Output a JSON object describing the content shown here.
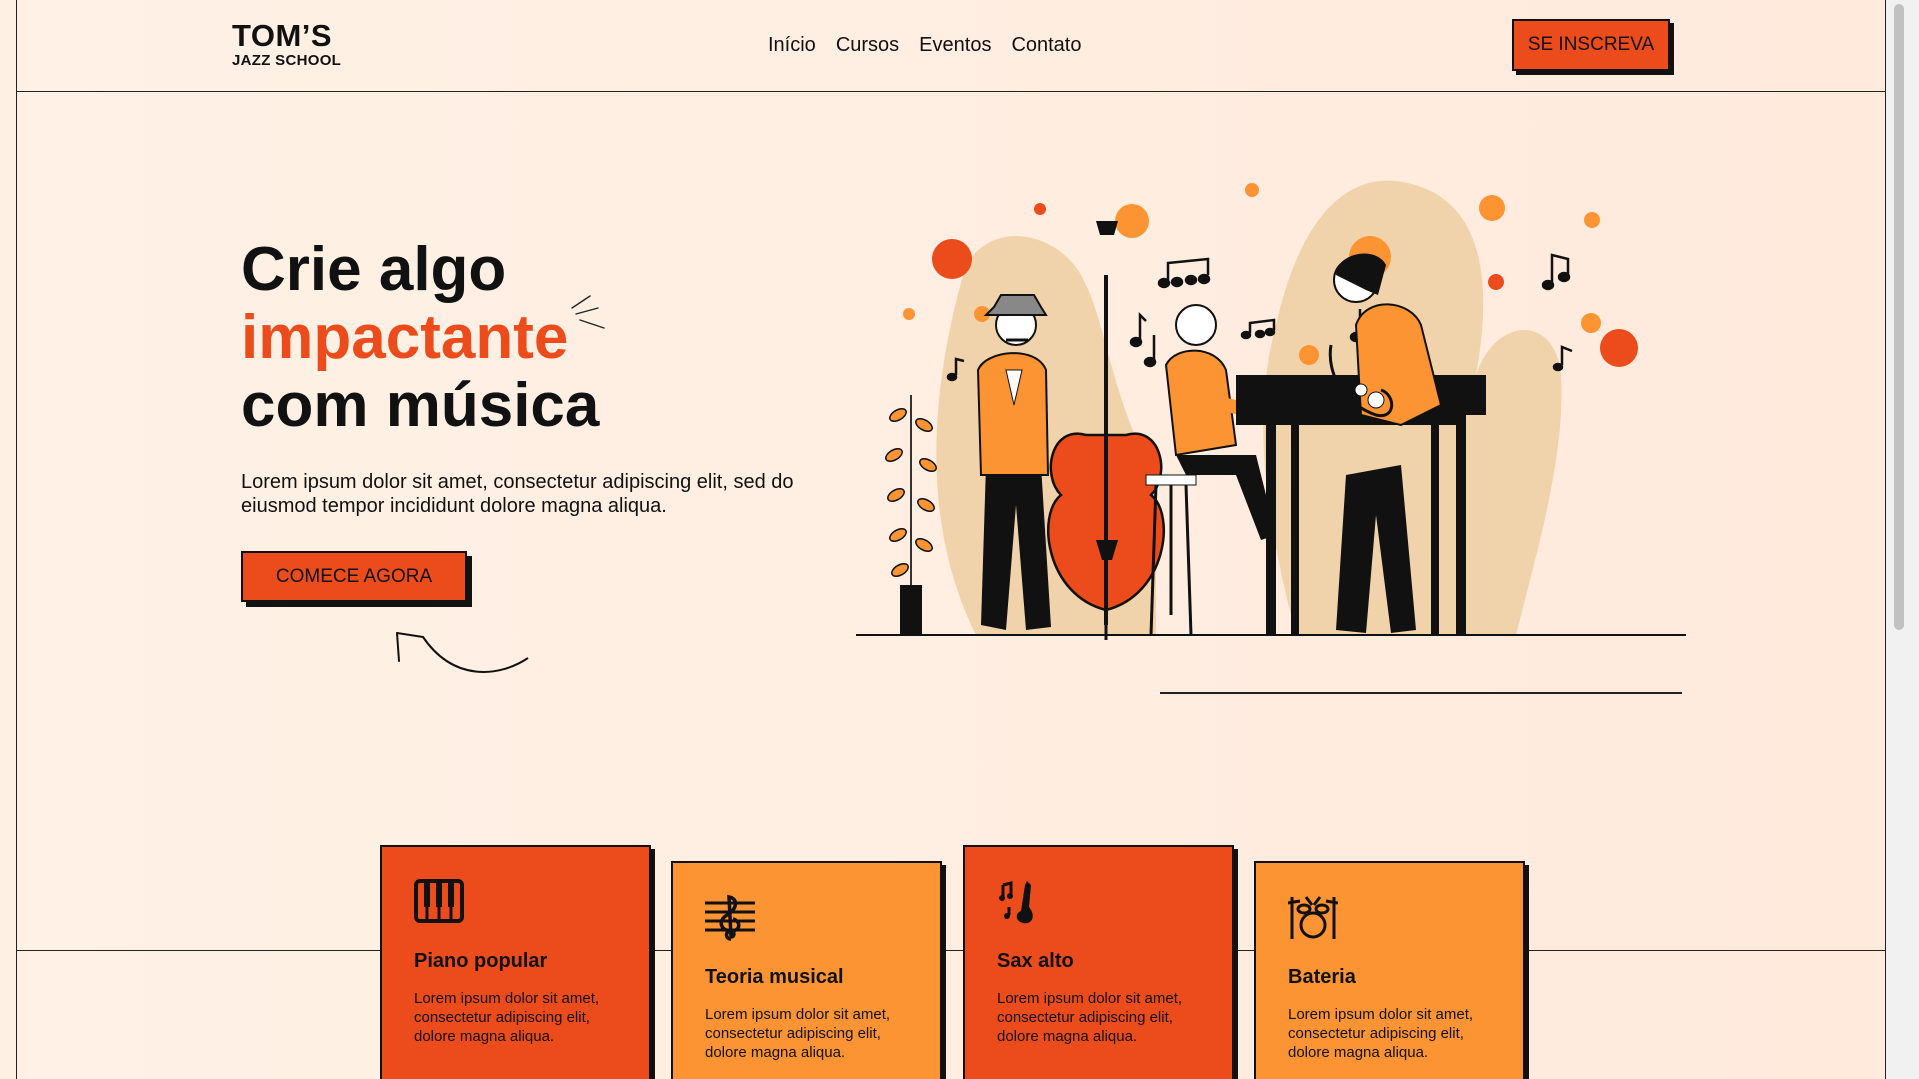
{
  "header": {
    "logo_line1": "TOM’S",
    "logo_line2": "JAZZ SCHOOL",
    "nav": [
      "Início",
      "Cursos",
      "Eventos",
      "Contato"
    ],
    "cta": "SE INSCREVA"
  },
  "hero": {
    "title_line1": "Crie algo",
    "title_accent": "impactante",
    "title_line3": "com música",
    "subtitle": "Lorem ipsum dolor sit amet, consectetur adipiscing elit, sed do eiusmod tempor incididunt dolore magna aliqua.",
    "cta": "COMECE AGORA"
  },
  "courses": [
    {
      "icon": "piano-icon",
      "title": "Piano popular",
      "text": "Lorem ipsum dolor sit amet, consectetur adipiscing elit, dolore magna aliqua.",
      "color": "#ec4b1c"
    },
    {
      "icon": "treble-clef-icon",
      "title": "Teoria musical",
      "text": "Lorem ipsum dolor sit amet, consectetur adipiscing elit, dolore magna aliqua.",
      "color": "#fd9434"
    },
    {
      "icon": "saxophone-icon",
      "title": "Sax alto",
      "text": "Lorem ipsum dolor sit amet, consectetur adipiscing elit, dolore magna aliqua.",
      "color": "#ec4b1c"
    },
    {
      "icon": "drums-icon",
      "title": "Bateria",
      "text": "Lorem ipsum dolor sit amet, consectetur adipiscing elit, dolore magna aliqua.",
      "color": "#fd9434"
    }
  ],
  "colors": {
    "accent": "#ec4b1c",
    "orange": "#fd9434",
    "background": "#fff0e4",
    "ink": "#111111"
  }
}
